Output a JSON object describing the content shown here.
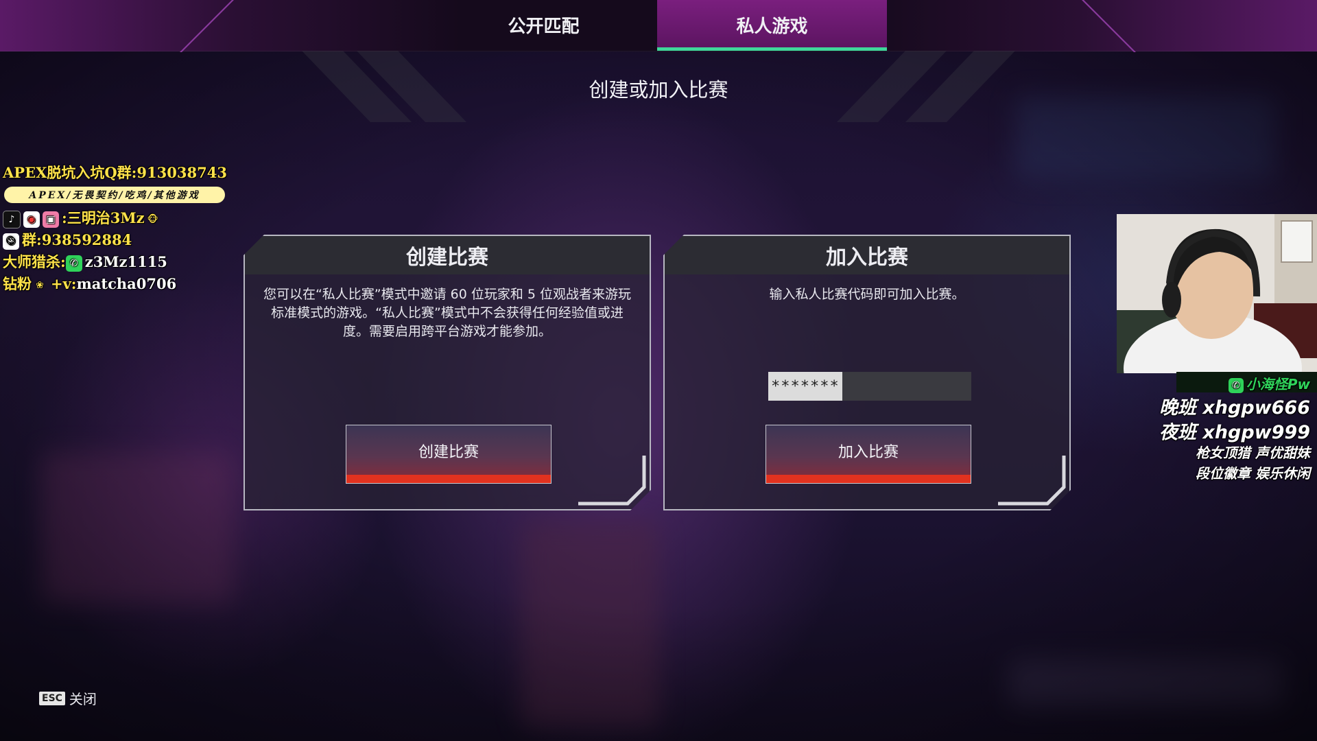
{
  "tabs": [
    {
      "label": "公开匹配",
      "active": false
    },
    {
      "label": "私人游戏",
      "active": true
    }
  ],
  "heading": "创建或加入比赛",
  "create_panel": {
    "title": "创建比赛",
    "description": "您可以在“私人比赛”模式中邀请 60 位玩家和 5 位观战者来游玩标准模式的游戏。“私人比赛”模式中不会获得任何经验值或进度。需要启用跨平台游戏才能参加。",
    "button_label": "创建比赛"
  },
  "join_panel": {
    "title": "加入比赛",
    "description": "输入私人比赛代码即可加入比赛。",
    "code_value": "********",
    "button_label": "加入比赛"
  },
  "footer": {
    "key": "ESC",
    "label": "关闭"
  },
  "stream_overlay": {
    "line1": "APEX脱坑入坑Q群:913038743",
    "pill": "APEX/无畏契约/吃鸡/其他游戏",
    "line3": ":三明治3Mz",
    "line4": "群:938592884",
    "line5_prefix": "大师猎杀:",
    "line5_value": "z3Mz1115",
    "line6_prefix": "钻粉",
    "line6_mid": "+v:",
    "line6_value": "matcha0706",
    "wechat_name": "小海怪Pw",
    "right_line1": "晚班 xhgpw666",
    "right_line2": "夜班 xhgpw999",
    "right_line3": "枪女顶猎 声优甜妹",
    "right_line4": "段位徽章 娱乐休闲"
  },
  "colors": {
    "tab_active": "#7a1f7e",
    "tab_underline": "#3fd69a",
    "button_bar": "#e2321f",
    "overlay_yellow": "#ffe24a",
    "overlay_green": "#2fd35a"
  }
}
